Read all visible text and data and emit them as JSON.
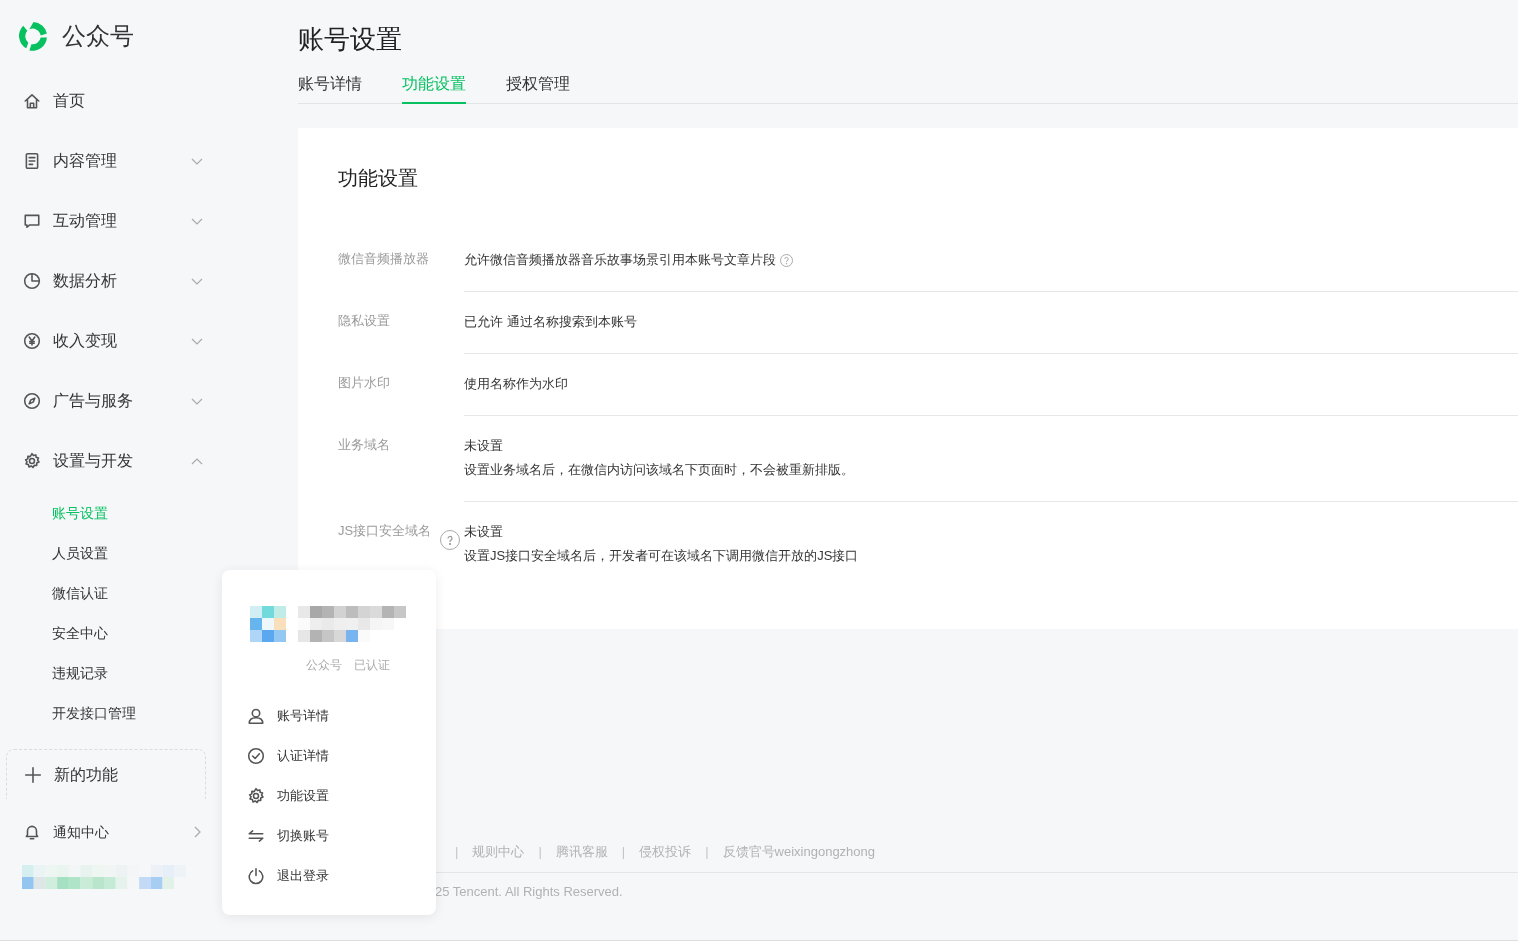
{
  "brand": {
    "name": "公众号"
  },
  "nav": [
    {
      "label": "首页",
      "kind": "link"
    },
    {
      "label": "内容管理",
      "kind": "group",
      "expanded": false
    },
    {
      "label": "互动管理",
      "kind": "group",
      "expanded": false
    },
    {
      "label": "数据分析",
      "kind": "group",
      "expanded": false
    },
    {
      "label": "收入变现",
      "kind": "group",
      "expanded": false
    },
    {
      "label": "广告与服务",
      "kind": "group",
      "expanded": false
    },
    {
      "label": "设置与开发",
      "kind": "group",
      "expanded": true,
      "children": [
        {
          "label": "账号设置",
          "selected": true
        },
        {
          "label": "人员设置",
          "selected": false
        },
        {
          "label": "微信认证",
          "selected": false
        },
        {
          "label": "安全中心",
          "selected": false
        },
        {
          "label": "违规记录",
          "selected": false
        },
        {
          "label": "开发接口管理",
          "selected": false
        }
      ]
    }
  ],
  "new_feature": {
    "label": "新的功能"
  },
  "notifications": {
    "label": "通知中心"
  },
  "page_title": "账号设置",
  "tabs": [
    {
      "label": "账号详情",
      "selected": false
    },
    {
      "label": "功能设置",
      "selected": true
    },
    {
      "label": "授权管理",
      "selected": false
    }
  ],
  "card": {
    "title": "功能设置",
    "rows": [
      {
        "label": "微信音频播放器",
        "lines": [
          "允许微信音频播放器音乐故事场景引用本账号文章片段"
        ],
        "value_help": true,
        "label_help": false
      },
      {
        "label": "隐私设置",
        "lines": [
          "已允许 通过名称搜索到本账号"
        ],
        "value_help": false,
        "label_help": false
      },
      {
        "label": "图片水印",
        "lines": [
          "使用名称作为水印"
        ],
        "value_help": false,
        "label_help": false
      },
      {
        "label": "业务域名",
        "lines": [
          "未设置",
          "设置业务域名后，在微信内访问该域名下页面时，不会被重新排版。"
        ],
        "value_help": false,
        "label_help": false
      },
      {
        "label": "JS接口安全域名",
        "lines": [
          "未设置",
          "设置JS接口安全域名后，开发者可在该域名下调用微信开放的JS接口"
        ],
        "value_help": false,
        "label_help": true
      }
    ]
  },
  "footer": {
    "links": [
      {
        "kind": "sep",
        "text": "|"
      },
      {
        "kind": "link",
        "text": "规则中心"
      },
      {
        "kind": "sep",
        "text": "|"
      },
      {
        "kind": "link",
        "text": "腾讯客服"
      },
      {
        "kind": "sep",
        "text": "|"
      },
      {
        "kind": "link",
        "text": "侵权投诉"
      },
      {
        "kind": "sep",
        "text": "|"
      },
      {
        "kind": "link",
        "text": "反馈官号weixingongzhong"
      }
    ],
    "copyright": "25 Tencent. All Rights Reserved."
  },
  "account_menu": {
    "tags": [
      "公众号",
      "已认证"
    ],
    "items": [
      {
        "label": "账号详情"
      },
      {
        "label": "认证详情"
      },
      {
        "label": "功能设置"
      },
      {
        "label": "切换账号"
      },
      {
        "label": "退出登录"
      }
    ]
  }
}
